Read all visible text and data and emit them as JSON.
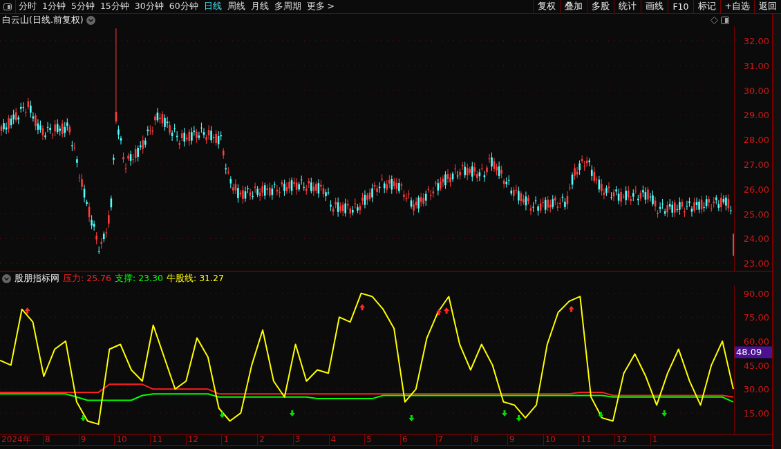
{
  "periods": [
    {
      "label": "分时",
      "selected": false
    },
    {
      "label": "1分钟",
      "selected": false
    },
    {
      "label": "5分钟",
      "selected": false
    },
    {
      "label": "15分钟",
      "selected": false
    },
    {
      "label": "30分钟",
      "selected": false
    },
    {
      "label": "60分钟",
      "selected": false
    },
    {
      "label": "日线",
      "selected": true
    },
    {
      "label": "周线",
      "selected": false
    },
    {
      "label": "月线",
      "selected": false
    },
    {
      "label": "多周期",
      "selected": false
    },
    {
      "label": "更多 >",
      "selected": false
    }
  ],
  "tools": [
    "复权",
    "叠加",
    "多股",
    "统计",
    "画线",
    "F10",
    "标记",
    "+自选",
    "返回"
  ],
  "price_panel": {
    "title": "白云山(日线.前复权)",
    "axis": [
      "32.00",
      "31.00",
      "30.00",
      "29.00",
      "28.00",
      "27.00",
      "26.00",
      "25.00",
      "24.00",
      "23.00"
    ]
  },
  "indicator_panel": {
    "title": "股朋指标网",
    "legend": [
      {
        "value": ": 25.76"
      },
      {
        "value": ": 23.30"
      },
      {
        "value": ": 31.27"
      }
    ],
    "cursor_value": "48.09",
    "chart_data": {
      "type": "line",
      "grid": true,
      "ylim": [
        2,
        95
      ],
      "yticks": [
        {
          "value": 15,
          "label": "15.00"
        },
        {
          "value": 30,
          "label": "30.00"
        },
        {
          "value": 45,
          "label": "45.00"
        },
        {
          "value": 60,
          "label": "60.00"
        },
        {
          "value": 75,
          "label": "75.00"
        },
        {
          "value": 90,
          "label": "90.00"
        }
      ],
      "series": [
        {
          "name": "压力",
          "color": "#ff2020",
          "values": [
            28,
            28,
            28,
            28,
            28,
            28,
            28,
            28,
            28,
            28,
            33,
            33,
            33,
            33,
            30,
            30,
            30,
            30,
            30,
            30,
            27,
            27,
            27,
            27,
            27,
            27,
            27,
            27,
            27,
            27,
            27,
            27,
            27,
            27,
            27,
            27,
            27,
            27,
            27,
            27,
            27,
            27,
            27,
            27,
            27,
            27,
            27,
            27,
            27,
            27,
            27,
            27,
            27,
            28,
            28,
            28,
            26,
            26,
            26,
            26,
            26,
            26,
            26,
            26,
            26,
            26,
            26,
            25
          ]
        },
        {
          "name": "支撑",
          "color": "#00ff00",
          "values": [
            27,
            27,
            27,
            27,
            27,
            27,
            27,
            25,
            23,
            23,
            23,
            23,
            23,
            26,
            27,
            27,
            27,
            27,
            27,
            27,
            25,
            25,
            25,
            25,
            25,
            25,
            25,
            25,
            25,
            24,
            24,
            24,
            24,
            24,
            24,
            26,
            26,
            26,
            26,
            26,
            26,
            26,
            26,
            26,
            26,
            26,
            26,
            26,
            26,
            26,
            26,
            26,
            26,
            26,
            26,
            26,
            25,
            25,
            25,
            25,
            25,
            25,
            25,
            25,
            25,
            25,
            25,
            22
          ]
        },
        {
          "name": "牛股线",
          "color": "#ffff00",
          "values": [
            48,
            45,
            80,
            72,
            38,
            55,
            60,
            22,
            10,
            8,
            55,
            58,
            42,
            35,
            70,
            50,
            30,
            35,
            62,
            50,
            18,
            10,
            15,
            45,
            67,
            35,
            25,
            58,
            35,
            42,
            40,
            75,
            72,
            90,
            88,
            80,
            68,
            22,
            30,
            62,
            78,
            88,
            58,
            42,
            58,
            45,
            22,
            20,
            12,
            20,
            58,
            78,
            85,
            88,
            25,
            12,
            10,
            40,
            52,
            38,
            20,
            40,
            55,
            35,
            20,
            45,
            60,
            30
          ]
        }
      ]
    }
  },
  "time_axis": [
    "2024年",
    "8",
    "9",
    "10",
    "11",
    "12",
    "1",
    "2",
    "3",
    "4",
    "5",
    "6",
    "7",
    "8",
    "9",
    "10",
    "11",
    "12",
    "1"
  ]
}
